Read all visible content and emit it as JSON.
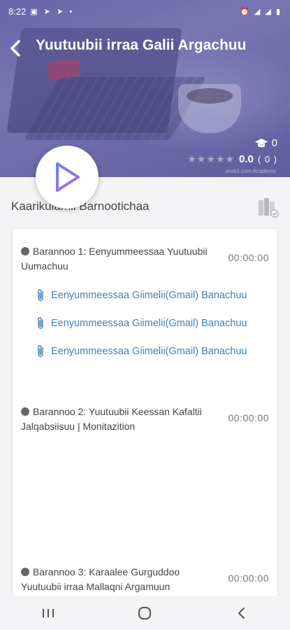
{
  "status_bar": {
    "time": "8:22",
    "left_icons": [
      "image-icon",
      "telegram-icon",
      "telegram-icon",
      "dot-icon"
    ],
    "right_icons": [
      "alarm-icon",
      "4g-signal-icon",
      "signal-icon",
      "4g-signal-icon",
      "signal-icon",
      "battery-icon"
    ]
  },
  "header": {
    "title": "Yuutuubii irraa Galii Argachuu",
    "students_count": "0",
    "rating_value": "0.0",
    "rating_count": "( 0 )",
    "stars": "★★★★★",
    "watermark": "eroict.com Academy"
  },
  "curriculum": {
    "title": "Kaarikulamii Barnootichaa",
    "lessons": [
      {
        "title": "Barannoo 1: Eenyummeessaa Yuutuubii Uumachuu",
        "time": "00:00:00",
        "attachments": [
          "Eenyummeessaa Giimelii(Gmail) Banachuu",
          "Eenyummeessaa Giimelii(Gmail) Banachuu",
          "Eenyummeessaa Giimelii(Gmail) Banachuu"
        ]
      },
      {
        "title": "Barannoo 2: Yuutuubii Keessan Kafaltii Jalqabsiisuu | Monitazition",
        "time": "00:00:00",
        "attachments": []
      },
      {
        "title": "Barannoo 3: Karaalee Gurguddoo Yuutuubii irraa Mallaqni Argamuun",
        "time": "00:00:00",
        "attachments": []
      }
    ]
  },
  "colors": {
    "accent": "#5c5aa6",
    "link": "#3f7fb5"
  },
  "navbar": {
    "icons": [
      "recent-apps-icon",
      "home-icon",
      "back-icon"
    ]
  }
}
